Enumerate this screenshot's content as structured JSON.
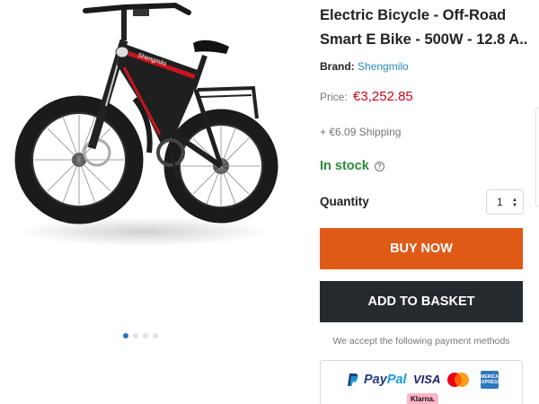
{
  "product": {
    "title_line1": "Electric Bicycle - Off-Road",
    "title_line2": "Smart E Bike - 500W - 12.8 A...",
    "brand_label": "Brand:",
    "brand_name": "Shengmilo",
    "price_label": "Price:",
    "price": "€3,252.85",
    "shipping": "+ €6.09 Shipping",
    "stock_status": "In stock",
    "stock_help_icon": "question-circle-icon",
    "bike_brand_mark": "Shengmilo"
  },
  "quantity": {
    "label": "Quantity",
    "value": "1"
  },
  "actions": {
    "buy_now": "BUY NOW",
    "add_to_basket": "ADD TO BASKET"
  },
  "payment": {
    "accept_text": "We accept the following payment methods",
    "methods": [
      "PayPal",
      "VISA",
      "Mastercard",
      "American Express",
      "Klarna."
    ],
    "paypal_part1": "Pay",
    "paypal_part2": "Pal",
    "visa": "VISA",
    "amex": "AMERICAN EXPRESS",
    "klarna": "Klarna."
  },
  "gallery": {
    "slide_count": 4,
    "active_slide": 1
  },
  "colors": {
    "buy_now": "#e05a17",
    "add_to_basket": "#252a2f",
    "price": "#d0021b",
    "in_stock": "#2b8a3e",
    "brand_link": "#2a8ab8",
    "active_dot": "#1f79c0"
  }
}
